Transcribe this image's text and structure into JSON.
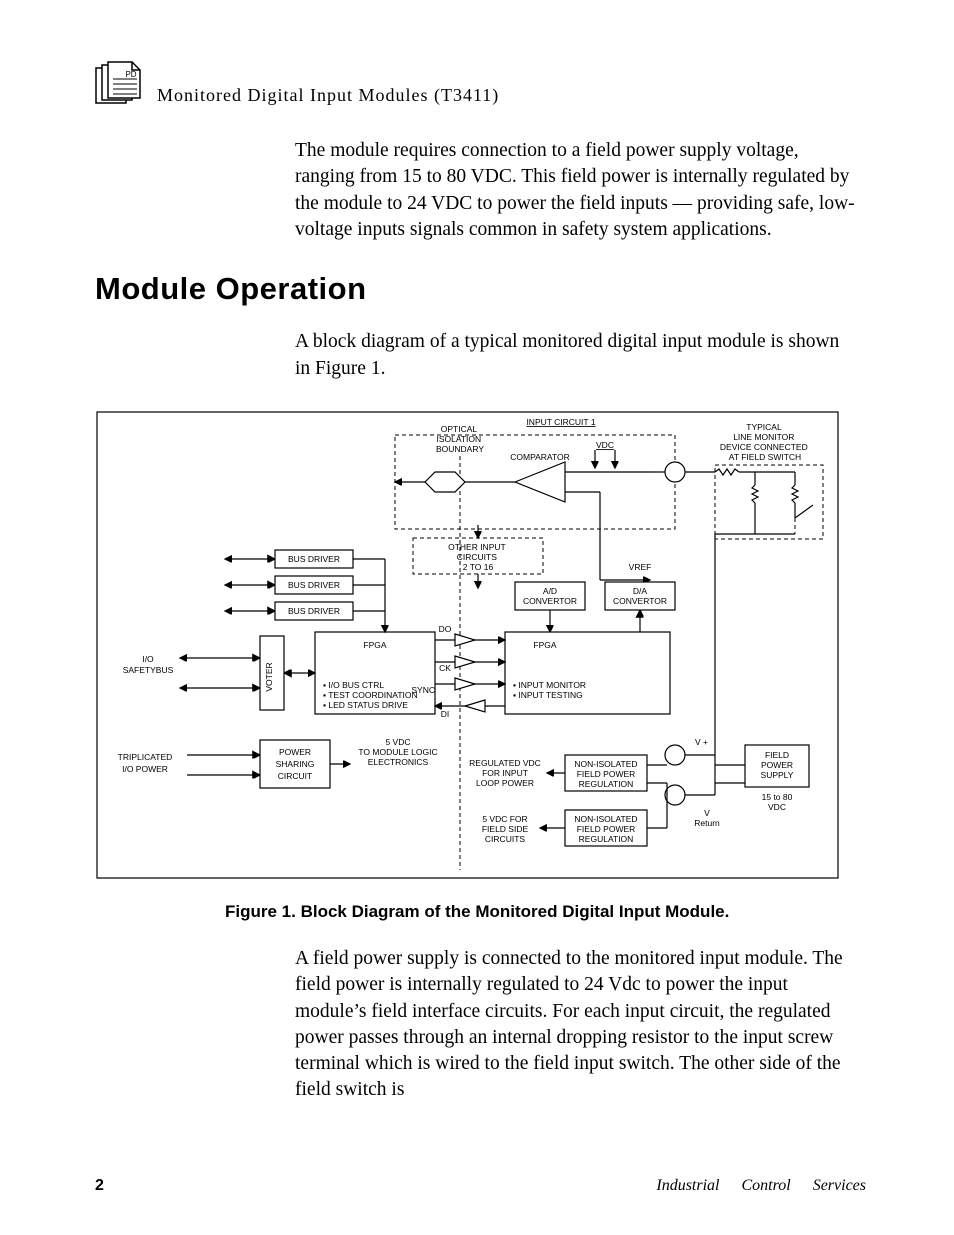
{
  "header": {
    "doc_icon_label": "PD",
    "title": "Monitored  Digital  Input  Modules (T3411)"
  },
  "paragraphs": {
    "intro": "The module requires connection to a field power supply voltage, ranging from 15 to 80 VDC.  This field power is internally regulated by the module to 24 VDC to power the field inputs — providing safe, low-voltage inputs signals common in safety system applications.",
    "section_heading": "Module Operation",
    "lead": "A block diagram of a typical monitored digital input module is shown in Figure 1.",
    "after_figure": "A field power supply is connected to the monitored input module.  The field power is internally regulated to 24 Vdc to power the input module’s field interface circuits.  For each input circuit, the regulated power passes through an internal dropping resistor to the input screw terminal which is wired to the field input switch.  The other side of the field switch is"
  },
  "figure": {
    "caption": "Figure 1.  Block Diagram of the Monitored Digital Input Module.",
    "labels": {
      "input_circuit": "INPUT  CIRCUIT  1",
      "optical_isolation": "OPTICAL\nISOLATION\nBOUNDARY",
      "typical_line_monitor": "TYPICAL\nLINE MONITOR\nDEVICE CONNECTED\nAT FIELD SWITCH",
      "vdc": "VDC",
      "comparator": "COMPARATOR",
      "other_inputs": "OTHER INPUT\nCIRCUITS\n2  TO  16",
      "bus_driver": "BUS DRIVER",
      "vref": "VREF",
      "ad": "A/D\nCONVERTOR",
      "da": "D/A\nCONVERTOR",
      "fpga_left": "FPGA",
      "fpga_right": "FPGA",
      "voter": "VOTER",
      "io_safetybus": "I/O\nSAFETYBUS",
      "do": "DO",
      "ck": "CK",
      "sync": "SYNC",
      "di": "DI",
      "fpga_left_bullets": "I/O BUS CTRL\nTEST COORDINATION\nLED STATUS DRIVE",
      "fpga_right_bullets": "INPUT MONITOR\nINPUT TESTING",
      "power_sharing": "POWER\nSHARING\nCIRCUIT",
      "five_vdc": "5  VDC\nTO MODULE LOGIC\nELECTRONICS",
      "triplicated": "TRIPLICATED\nI/O POWER",
      "regulated_vdc": "REGULATED VDC\nFOR INPUT\nLOOP POWER",
      "non_iso_fp_reg": "NON-ISOLATED\nFIELD POWER\nREGULATION",
      "five_vdc_field": "5 VDC FOR\nFIELD SIDE\nCIRCUITS",
      "non_iso_fp_reg2": "NON-ISOLATED\nFIELD POWER\nREGULATION",
      "vplus": "V +",
      "vreturn": "V\nReturn",
      "field_power_supply": "FIELD\nPOWER\nSUPPLY",
      "fps_range": "15 to 80\nVDC"
    }
  },
  "footer": {
    "page_number": "2",
    "brand": "Industrial Control Services"
  }
}
